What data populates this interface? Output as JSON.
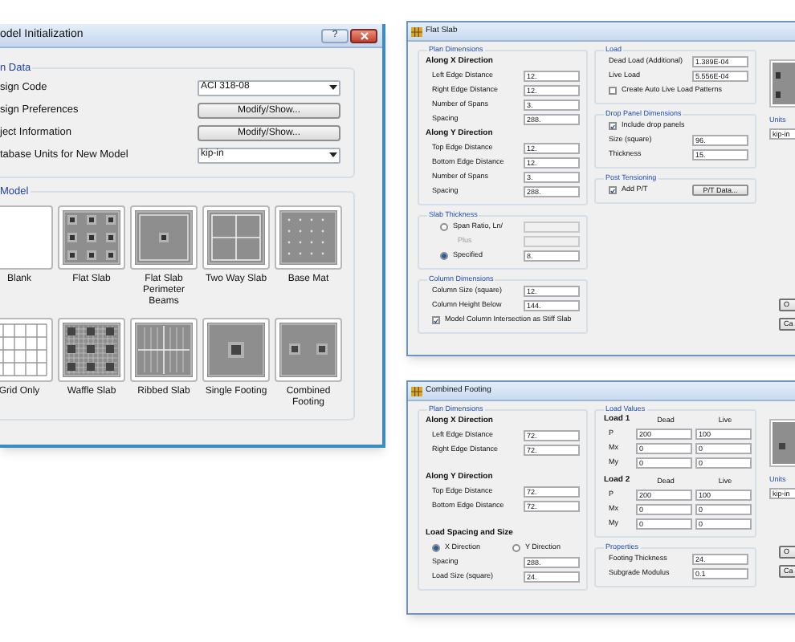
{
  "model_window": {
    "title": "odel Initialization",
    "help_button": "?",
    "data_group": {
      "label": "n Data",
      "rows": [
        {
          "label": "sign Code",
          "kind": "dropdown",
          "value": "ACI 318-08"
        },
        {
          "label": "sign Preferences",
          "kind": "button",
          "value": "Modify/Show..."
        },
        {
          "label": "ject Information",
          "kind": "button",
          "value": "Modify/Show..."
        },
        {
          "label": "tabase Units for New Model",
          "kind": "dropdown",
          "value": "kip-in"
        }
      ]
    },
    "model_group": {
      "label": "Model",
      "templates": [
        {
          "label": "Blank",
          "kind": "blank"
        },
        {
          "label": "Flat Slab",
          "kind": "flat_slab"
        },
        {
          "label": "Flat Slab Perimeter Beams",
          "kind": "perimeter_beams"
        },
        {
          "label": "Two Way Slab",
          "kind": "two_way"
        },
        {
          "label": "Base Mat",
          "kind": "base_mat"
        },
        {
          "label": "Grid Only",
          "kind": "grid"
        },
        {
          "label": "Waffle Slab",
          "kind": "waffle"
        },
        {
          "label": "Ribbed Slab",
          "kind": "ribbed"
        },
        {
          "label": "Single Footing",
          "kind": "single_footing"
        },
        {
          "label": "Combined Footing",
          "kind": "combined_footing"
        }
      ]
    }
  },
  "flat_slab": {
    "title": "Flat Slab",
    "left_groups": [
      {
        "label": "Plan Dimensions",
        "items": [
          {
            "kind": "heading",
            "text": "Along X Direction"
          },
          {
            "kind": "field",
            "label": "Left Edge Distance",
            "value": "12."
          },
          {
            "kind": "field",
            "label": "Right Edge Distance",
            "value": "12."
          },
          {
            "kind": "field",
            "label": "Number of Spans",
            "value": "3."
          },
          {
            "kind": "field",
            "label": "Spacing",
            "value": "288."
          },
          {
            "kind": "heading",
            "text": "Along Y Direction"
          },
          {
            "kind": "field",
            "label": "Top Edge Distance",
            "value": "12."
          },
          {
            "kind": "field",
            "label": "Bottom Edge Distance",
            "value": "12."
          },
          {
            "kind": "field",
            "label": "Number of Spans",
            "value": "3."
          },
          {
            "kind": "field",
            "label": "Spacing",
            "value": "288."
          }
        ]
      },
      {
        "label": "Slab Thickness",
        "items": [
          {
            "kind": "radio_field",
            "label": "Span Ratio, Ln/",
            "selected": false
          },
          {
            "kind": "label_field",
            "label": "Plus",
            "disabled": true
          },
          {
            "kind": "radio_field",
            "label": "Specified",
            "selected": true,
            "value": "8."
          }
        ]
      },
      {
        "label": "Column Dimensions",
        "items": [
          {
            "kind": "field",
            "label": "Column Size (square)",
            "value": "12."
          },
          {
            "kind": "field",
            "label": "Column Height Below",
            "value": "144."
          },
          {
            "kind": "checkbox",
            "label": "Model Column Intersection as Stiff Slab",
            "checked": true
          }
        ]
      }
    ],
    "mid_groups": [
      {
        "label": "Load",
        "items": [
          {
            "kind": "field",
            "label": "Dead Load (Additional)",
            "value": "1.389E-04"
          },
          {
            "kind": "field",
            "label": "Live Load",
            "value": "5.556E-04"
          },
          {
            "kind": "checkbox",
            "label": "Create Auto Live Load Patterns",
            "checked": false
          }
        ]
      },
      {
        "label": "Drop Panel Dimensions",
        "items": [
          {
            "kind": "checkbox",
            "label": "Include drop panels",
            "checked": true
          },
          {
            "kind": "field",
            "label": "Size (square)",
            "value": "96."
          },
          {
            "kind": "field",
            "label": "Thickness",
            "value": "15."
          }
        ]
      },
      {
        "label": "Post Tensioning",
        "items": [
          {
            "kind": "checkbox_button",
            "label": "Add P/T",
            "checked": true,
            "button": "P/T Data..."
          }
        ]
      }
    ],
    "units": {
      "label": "Units",
      "value": "kip-in"
    },
    "buttons": [
      "O",
      "Ca"
    ]
  },
  "combined_footing": {
    "title": "Combined Footing",
    "left_groups": [
      {
        "label": "Plan Dimensions",
        "items": [
          {
            "kind": "heading",
            "text": "Along X Direction"
          },
          {
            "kind": "field",
            "label": "Left Edge Distance",
            "value": "72."
          },
          {
            "kind": "field",
            "label": "Right Edge Distance",
            "value": "72."
          },
          {
            "kind": "heading",
            "text": "Along Y Direction"
          },
          {
            "kind": "field",
            "label": "Top Edge Distance",
            "value": "72."
          },
          {
            "kind": "field",
            "label": "Bottom Edge Distance",
            "value": "72."
          },
          {
            "kind": "heading",
            "text": "Load Spacing and Size"
          },
          {
            "kind": "radio_row",
            "options": [
              {
                "label": "X Direction",
                "selected": true
              },
              {
                "label": "Y Direction",
                "selected": false
              }
            ]
          },
          {
            "kind": "field",
            "label": "Spacing",
            "value": "288."
          },
          {
            "kind": "field",
            "label": "Load Size (square)",
            "value": "24."
          }
        ]
      }
    ],
    "mid_groups": [
      {
        "label": "Load Values",
        "items": [
          {
            "kind": "load_table",
            "heading": "Load 1",
            "columns": [
              "Dead",
              "Live"
            ],
            "rows": [
              {
                "label": "P",
                "values": [
                  "200",
                  "100"
                ]
              },
              {
                "label": "Mx",
                "values": [
                  "0",
                  "0"
                ]
              },
              {
                "label": "My",
                "values": [
                  "0",
                  "0"
                ]
              }
            ]
          },
          {
            "kind": "load_table",
            "heading": "Load 2",
            "columns": [
              "Dead",
              "Live"
            ],
            "rows": [
              {
                "label": "P",
                "values": [
                  "200",
                  "100"
                ]
              },
              {
                "label": "Mx",
                "values": [
                  "0",
                  "0"
                ]
              },
              {
                "label": "My",
                "values": [
                  "0",
                  "0"
                ]
              }
            ]
          }
        ]
      },
      {
        "label": "Properties",
        "items": [
          {
            "kind": "field",
            "label": "Footing Thickness",
            "value": "24."
          },
          {
            "kind": "field",
            "label": "Subgrade Modulus",
            "value": "0.1"
          }
        ]
      }
    ],
    "units": {
      "label": "Units",
      "value": "kip-in"
    },
    "buttons": [
      "O",
      "Ca"
    ]
  }
}
